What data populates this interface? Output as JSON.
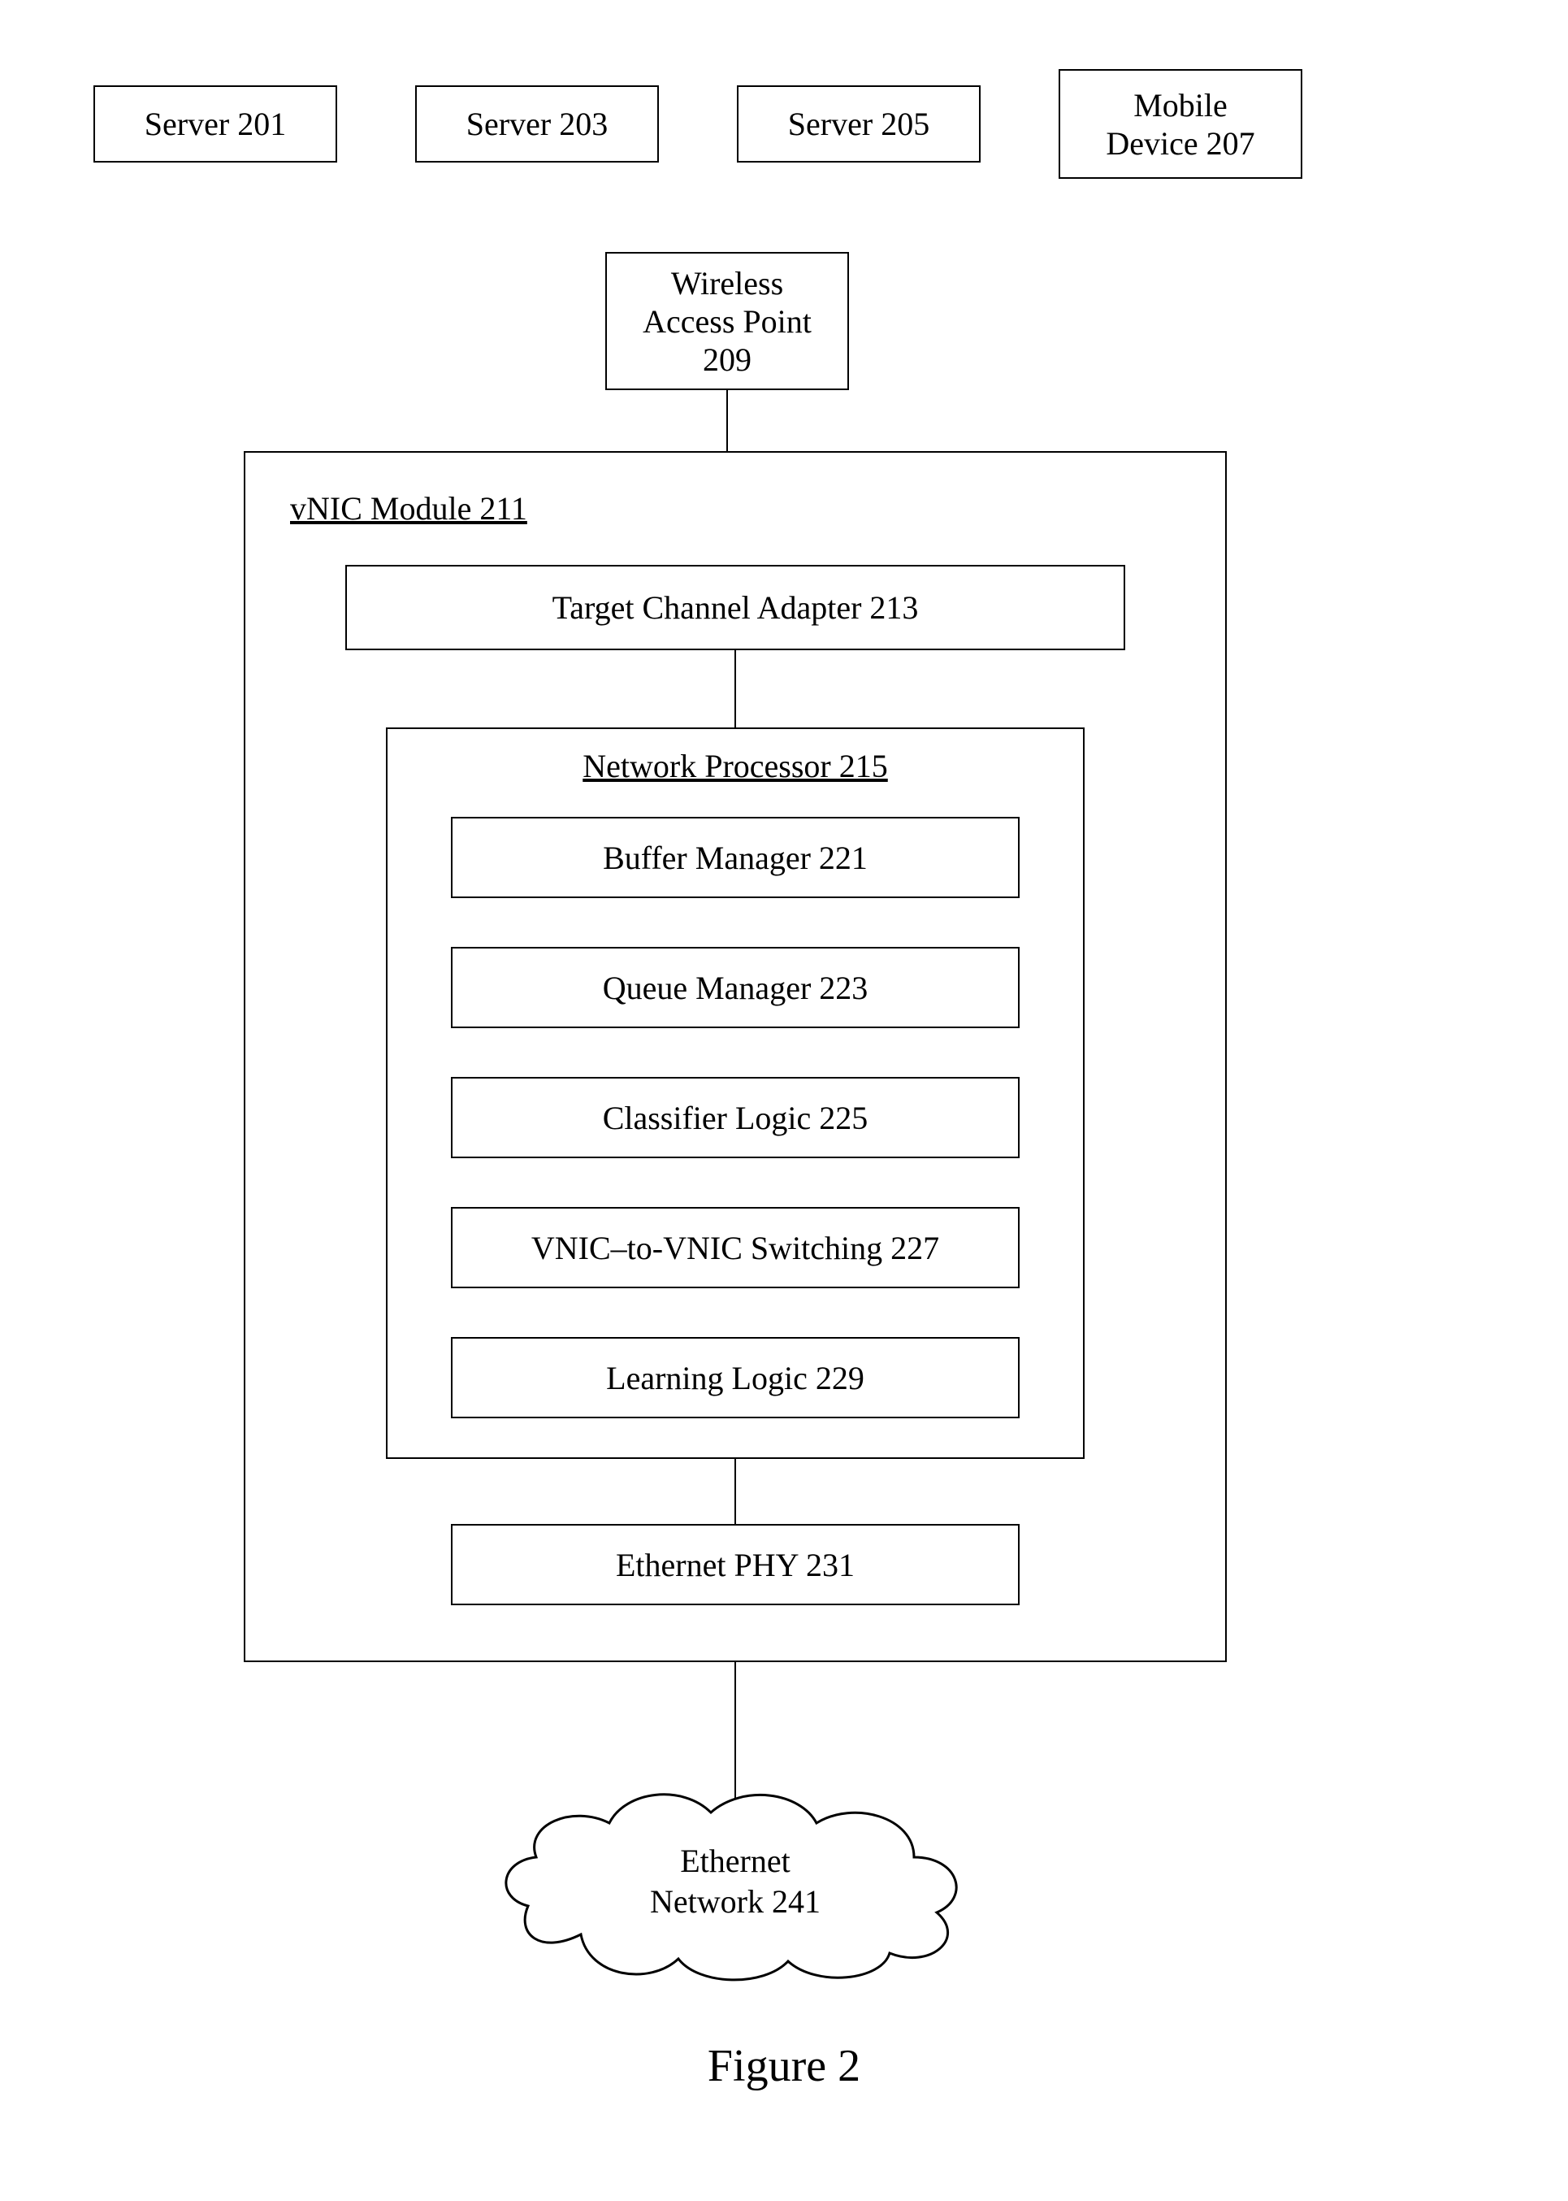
{
  "top": {
    "server1": "Server 201",
    "server2": "Server 203",
    "server3": "Server 205",
    "mobile": "Mobile\nDevice 207"
  },
  "wap": "Wireless\nAccess Point\n209",
  "module_title": "vNIC Module 211",
  "tca": "Target Channel Adapter 213",
  "np_title": "Network Processor 215",
  "np_items": {
    "buffer": "Buffer Manager 221",
    "queue": "Queue Manager 223",
    "classifier": "Classifier Logic 225",
    "switching": "VNIC–to-VNIC Switching 227",
    "learning": "Learning Logic 229"
  },
  "phy": "Ethernet PHY 231",
  "cloud": "Ethernet\nNetwork 241",
  "caption": "Figure 2"
}
